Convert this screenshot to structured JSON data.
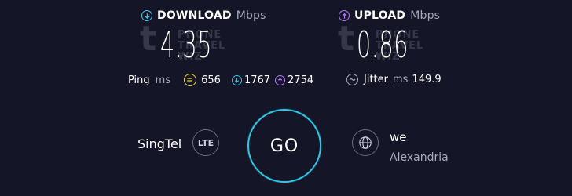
{
  "download": {
    "label": "DOWNLOAD",
    "unit": "Mbps",
    "value": "4.35"
  },
  "upload": {
    "label": "UPLOAD",
    "unit": "Mbps",
    "value": "0.86"
  },
  "watermark": {
    "letter": "t",
    "line1": "PHONE",
    "line2": "TRAVEL",
    "line3": "WIZ"
  },
  "ping": {
    "label": "Ping",
    "unit": "ms",
    "idle": "656",
    "download": "1767",
    "upload": "2754"
  },
  "jitter": {
    "label": "Jitter",
    "unit": "ms",
    "value": "149.9"
  },
  "provider": {
    "name": "SingTel",
    "tech": "LTE"
  },
  "go": {
    "label": "GO"
  },
  "server": {
    "name": "we",
    "location": "Alexandria"
  },
  "colors": {
    "background": "#141526",
    "download_accent": "#2ec8e6",
    "upload_accent": "#b07cf0",
    "idle_accent": "#e8d34a",
    "muted": "#a7a9bf"
  },
  "icons": {
    "download": "download-arrow-icon",
    "upload": "upload-arrow-icon",
    "idle": "idle-ping-icon",
    "jitter": "jitter-wave-icon",
    "server": "globe-icon"
  }
}
